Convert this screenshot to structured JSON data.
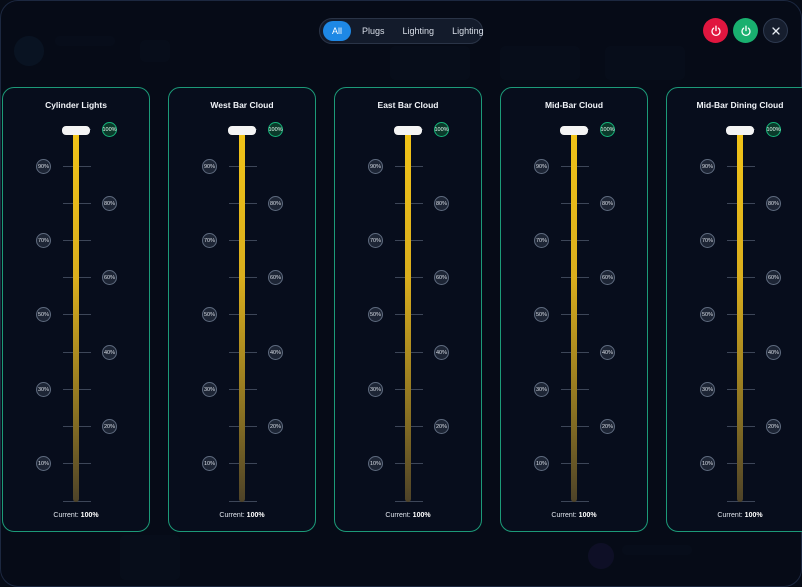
{
  "filters": {
    "tabs": [
      {
        "label": "All",
        "active": true
      },
      {
        "label": "Plugs",
        "active": false
      },
      {
        "label": "Lighting",
        "active": false
      },
      {
        "label": "Lighting",
        "active": false
      }
    ]
  },
  "controls": {
    "power_off_icon": "power-icon",
    "power_on_icon": "power-icon",
    "close_icon": "close-icon",
    "colors": {
      "power_off": "#e0163f",
      "power_on": "#19b06f",
      "accent": "#1e88e5",
      "panel_border": "#1c9a78"
    }
  },
  "scale": {
    "left_labels": [
      "90%",
      "70%",
      "50%",
      "30%",
      "10%"
    ],
    "right_labels": [
      "100%",
      "80%",
      "60%",
      "40%",
      "20%"
    ]
  },
  "lights": [
    {
      "name": "Cylinder Lights",
      "current_label": "Current:",
      "current_value": "100%",
      "level": 1.0
    },
    {
      "name": "West Bar Cloud",
      "current_label": "Current:",
      "current_value": "100%",
      "level": 1.0
    },
    {
      "name": "East Bar Cloud",
      "current_label": "Current:",
      "current_value": "100%",
      "level": 1.0
    },
    {
      "name": "Mid-Bar Cloud",
      "current_label": "Current:",
      "current_value": "100%",
      "level": 1.0
    },
    {
      "name": "Mid-Bar Dining Cloud",
      "current_label": "Current:",
      "current_value": "100%",
      "level": 1.0
    }
  ]
}
